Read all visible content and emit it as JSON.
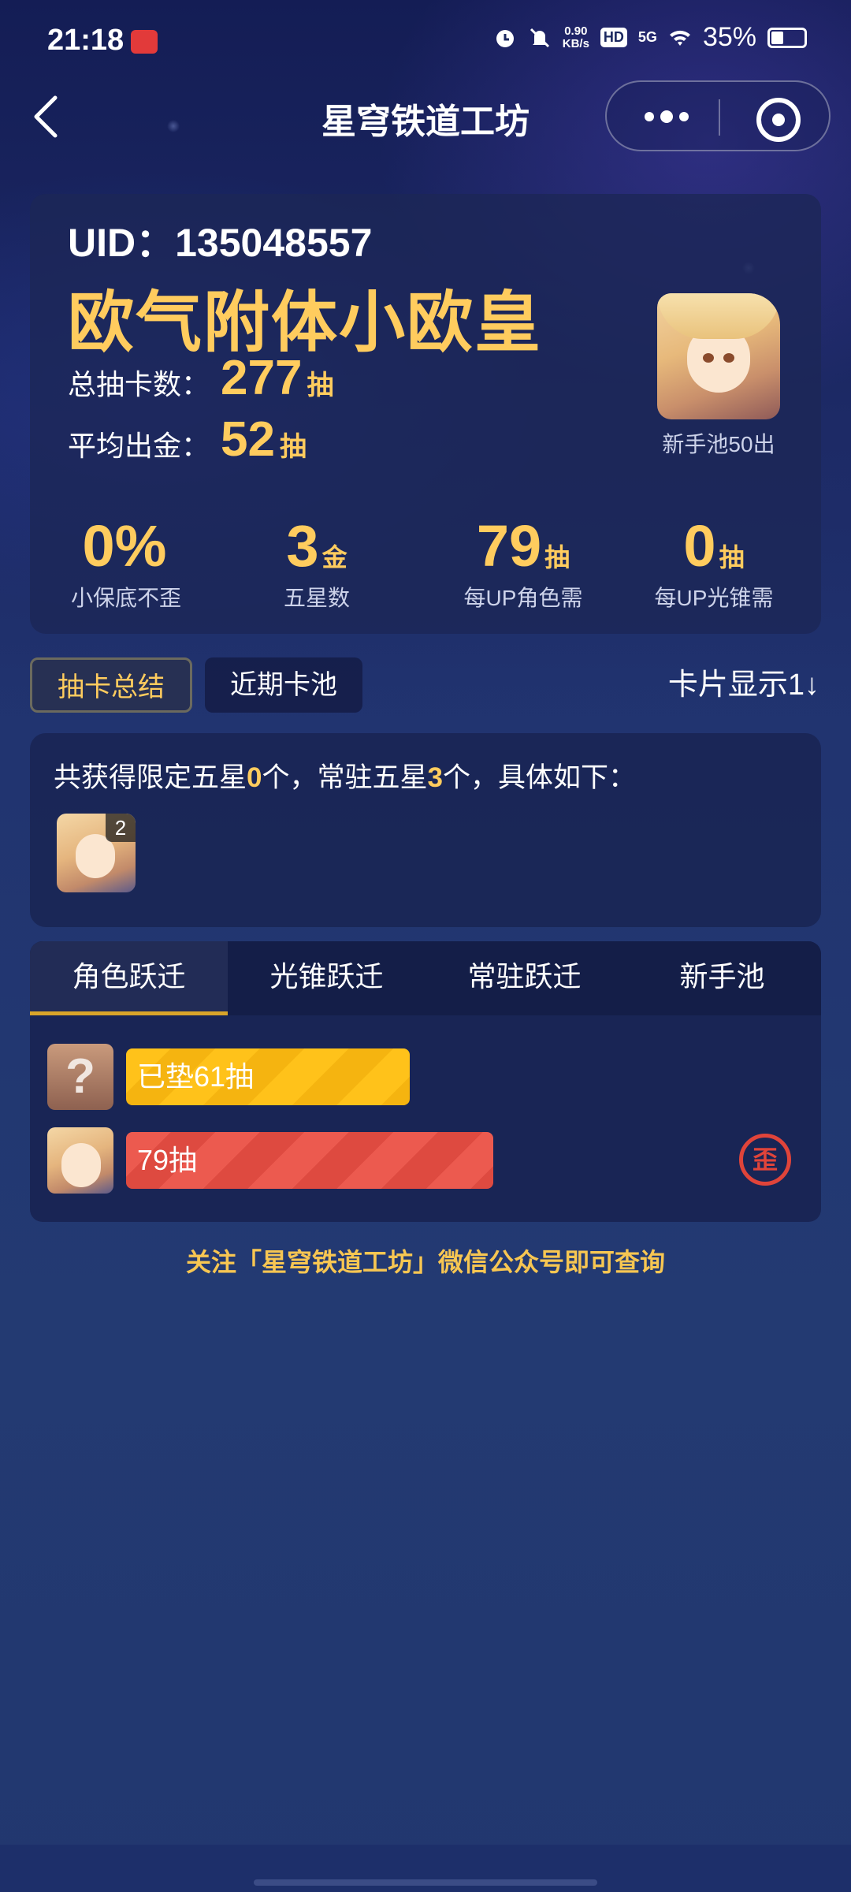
{
  "status_bar": {
    "time": "21:18",
    "net_speed": "0.90",
    "net_unit": "KB/s",
    "hd": "HD",
    "signal": "5G",
    "battery": "35%"
  },
  "nav": {
    "title": "星穹铁道工坊"
  },
  "profile": {
    "uid": "UID：135048557",
    "luck_title": "欧气附体小欧皇",
    "total_label": "总抽卡数：",
    "total_value": "277",
    "total_unit": "抽",
    "avg_label": "平均出金：",
    "avg_value": "52",
    "avg_unit": "抽",
    "avatar_caption": "新手池50出",
    "kpis": [
      {
        "value": "0%",
        "unit": "",
        "label": "小保底不歪"
      },
      {
        "value": "3",
        "unit": "金",
        "label": "五星数"
      },
      {
        "value": "79",
        "unit": "抽",
        "label": "每UP角色需"
      },
      {
        "value": "0",
        "unit": "抽",
        "label": "每UP光锥需"
      }
    ]
  },
  "tabs": {
    "summary": "抽卡总结",
    "recent": "近期卡池",
    "display_option": "卡片显示1↓"
  },
  "summary": {
    "text_1": "共获得限定五星",
    "limited_count": "0",
    "text_2": "个，常驻五星",
    "standard_count": "3",
    "text_3": "个，具体如下：",
    "char_count_badge": "2"
  },
  "pool": {
    "tabs": [
      "角色跃迁",
      "光锥跃迁",
      "常驻跃迁",
      "新手池"
    ],
    "active_tab": "角色跃迁",
    "rows": [
      {
        "label": "已垫61抽",
        "pity_fraction": 0.61,
        "color": "#ffc21a",
        "icon": "question-mark-icon"
      },
      {
        "label": "79抽",
        "pity_fraction": 0.79,
        "color": "#ec5a4f",
        "icon": "character-avatar",
        "badge": "歪"
      }
    ],
    "unknown_symbol": "?"
  },
  "footer": {
    "note": "关注「星穹铁道工坊」微信公众号即可查询"
  }
}
